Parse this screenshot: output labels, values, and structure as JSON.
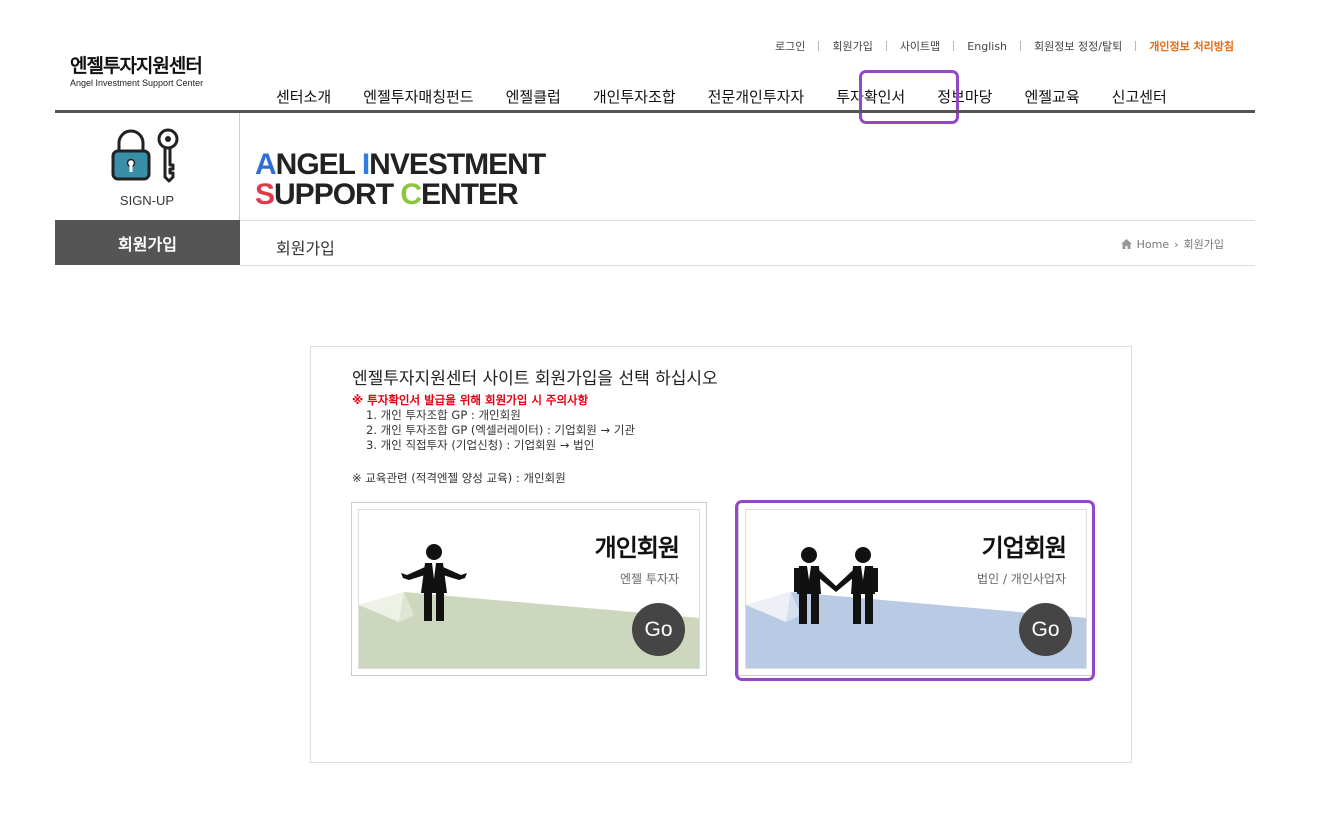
{
  "header": {
    "logo_ko": "엔젤투자지원센터",
    "logo_en": "Angel Investment Support Center"
  },
  "util_links": [
    "로그인",
    "회원가입",
    "사이트맵",
    "English",
    "회원정보 정정/탈퇴",
    "개인정보 처리방침"
  ],
  "gnb": [
    "센터소개",
    "엔젤투자매칭펀드",
    "엔젤클럽",
    "개인투자조합",
    "전문개인투자자",
    "투자확인서",
    "정보마당",
    "엔젤교육",
    "신고센터"
  ],
  "sidebar": {
    "label": "SIGN-UP",
    "menu": "회원가입"
  },
  "banner": {
    "line1_first": "A",
    "line1_mid": "NGEL ",
    "line1_i": "I",
    "line1_rest": "NVESTMENT",
    "line2_first": "S",
    "line2_mid": "UPPORT ",
    "line2_c": "C",
    "line2_rest": "ENTER"
  },
  "page_title": "회원가입",
  "breadcrumb": {
    "home": "Home",
    "current": "회원가입"
  },
  "main": {
    "title": "엔젤투자지원센터 사이트 회원가입을 선택 하십시오",
    "notice_title": "※ 투자확인서 발급을 위해 회원가입 시 주의사항",
    "notice_items": [
      "1. 개인 투자조합 GP : 개인회원",
      "2. 개인 투자조합 GP (엑셀러레이터) : 기업회원 → 기관",
      "3. 개인 직접투자 (기업신청) : 기업회원 → 법인"
    ],
    "notice2": "※ 교육관련 (적격엔젤 양성 교육) : 개인회원"
  },
  "cards": [
    {
      "title": "개인회원",
      "sub": "엔젤 투자자",
      "go": "Go",
      "color": "#cdd7bd"
    },
    {
      "title": "기업회원",
      "sub": "법인 / 개인사업자",
      "go": "Go",
      "color": "#b9cbe4"
    }
  ],
  "colors": {
    "accent_purple": "#9347c9",
    "notice_red": "#e60012",
    "util_orange": "#e36b14",
    "banner_A": "#2f6fd1",
    "banner_I": "#2f7de1",
    "banner_S": "#e0394a",
    "banner_C": "#8cc63f"
  }
}
